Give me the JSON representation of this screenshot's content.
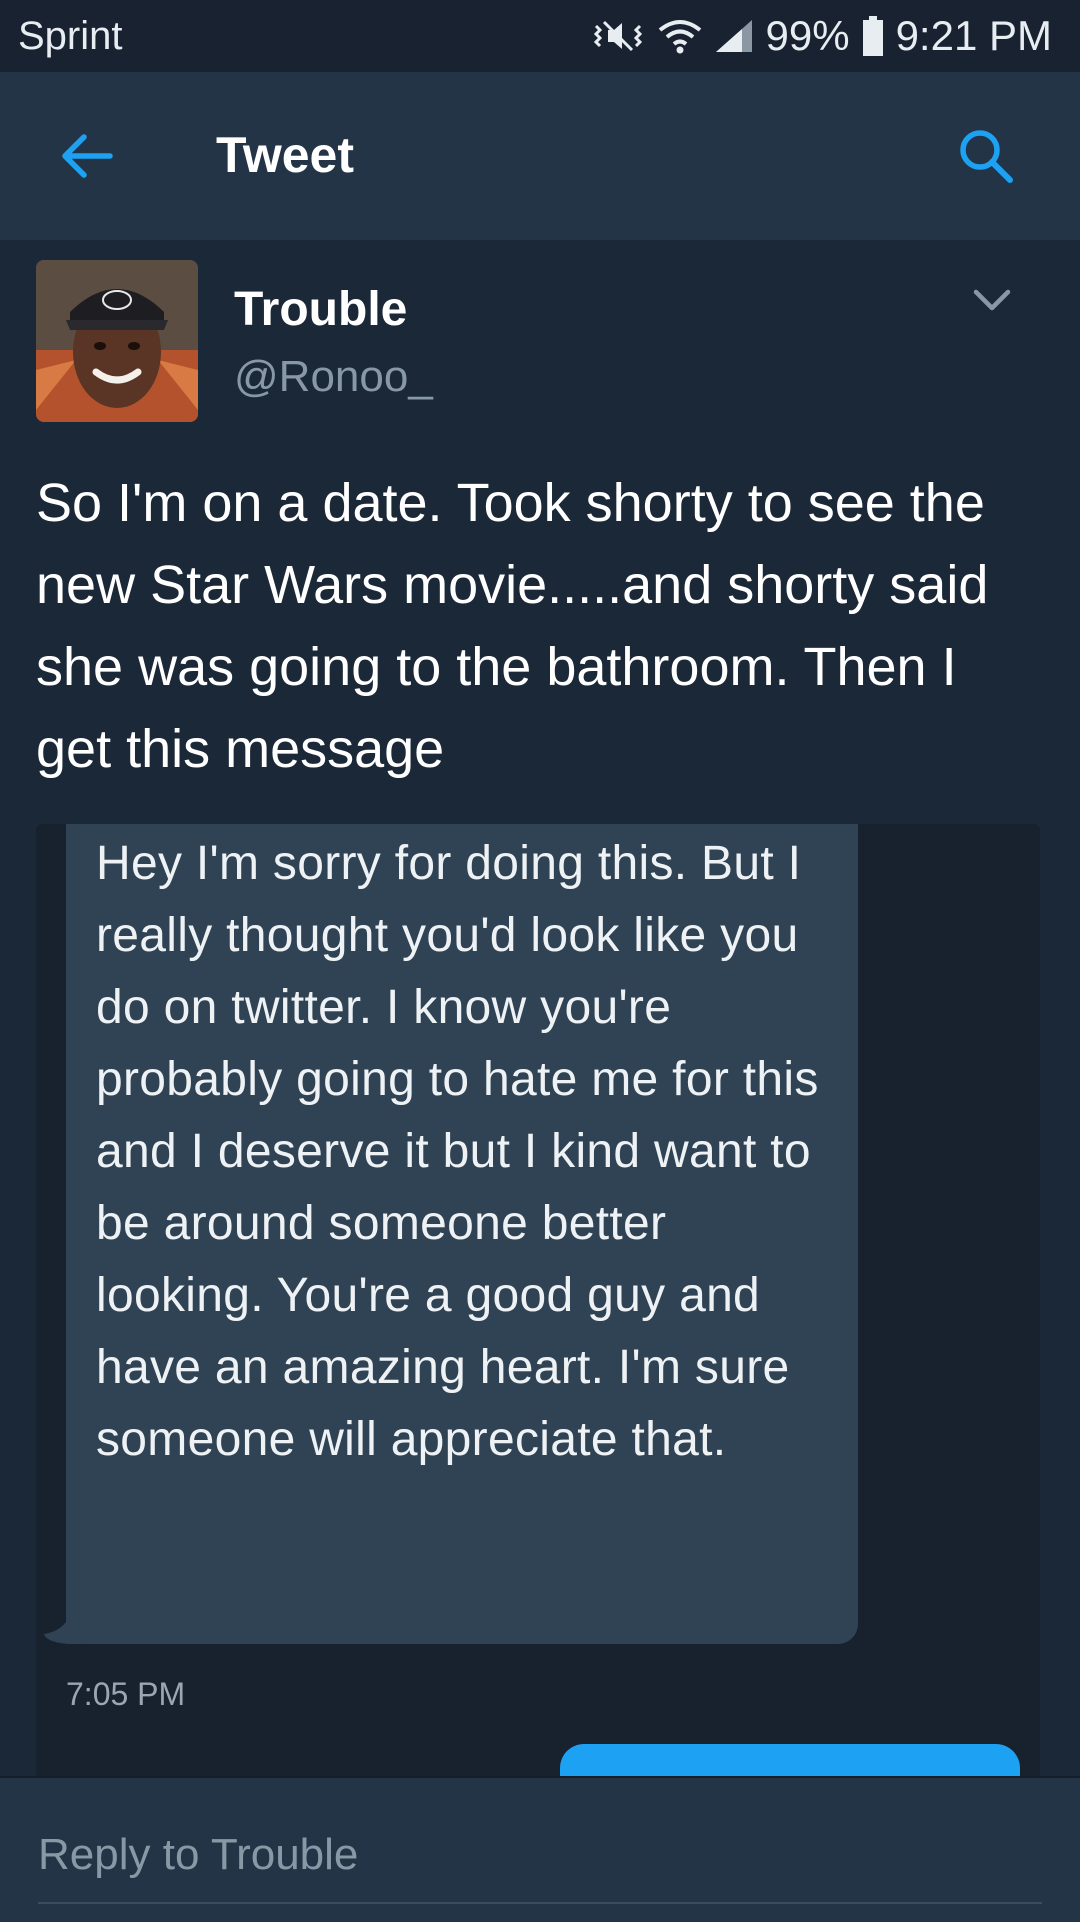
{
  "status_bar": {
    "carrier": "Sprint",
    "battery": "99%",
    "time": "9:21 PM"
  },
  "header": {
    "title": "Tweet",
    "back_icon": "back-arrow-icon",
    "search_icon": "search-icon"
  },
  "tweet": {
    "display_name": "Trouble",
    "handle": "@Ronoo_",
    "text": "So I'm on a date. Took shorty to see the new Star Wars movie.....and shorty said she was going to the bathroom. Then I get this message",
    "media": {
      "message_text": "Hey I'm sorry for doing this. But I really thought you'd look like you do on twitter. I know you're probably going to hate me for this and I deserve it but I kind want to be around someone better looking. You're a good guy and have an amazing heart. I'm sure someone will appreciate that.",
      "message_time": "7:05 PM"
    }
  },
  "reply": {
    "placeholder": "Reply to Trouble"
  },
  "colors": {
    "background": "#1b2837",
    "header": "#243447",
    "accent": "#1da1f2",
    "secondary_text": "#8899a6"
  }
}
